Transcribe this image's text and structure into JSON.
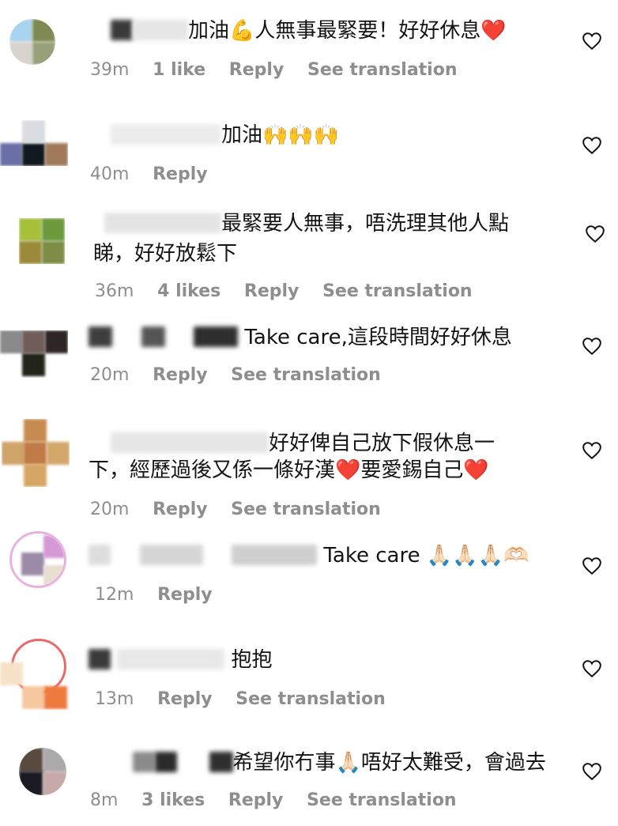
{
  "comments": [
    {
      "text": "加油💪人無事最緊要！好好休息❤️",
      "time": "39m",
      "likes": "1 like",
      "reply": "Reply",
      "translate": "See translation"
    },
    {
      "text": "加油🙌🙌🙌",
      "time": "40m",
      "likes": "",
      "reply": "Reply",
      "translate": ""
    },
    {
      "text_line1": "最緊要人無事，唔洗理其他人點",
      "text_line2": "睇，好好放鬆下",
      "time": "36m",
      "likes": "4 likes",
      "reply": "Reply",
      "translate": "See translation"
    },
    {
      "text": "Take care,這段時間好好休息",
      "time": "20m",
      "likes": "",
      "reply": "Reply",
      "translate": "See translation"
    },
    {
      "text_line1": "好好俾自己放下假休息一",
      "text_line2": "下，經歷過後又係一條好漢❤️要愛錫自己❤️",
      "time": "20m",
      "likes": "",
      "reply": "Reply",
      "translate": "See translation"
    },
    {
      "text": "Take care 🙏🏻🙏🏻🙏🏻🫶🏻",
      "time": "12m",
      "likes": "",
      "reply": "Reply",
      "translate": ""
    },
    {
      "text": "抱抱",
      "time": "13m",
      "likes": "",
      "reply": "Reply",
      "translate": "See translation"
    },
    {
      "text": "希望你冇事🙏🏻唔好太難受，會過去",
      "time": "8m",
      "likes": "3 likes",
      "reply": "Reply",
      "translate": "See translation"
    }
  ],
  "icons": {
    "like": "heart-outline-icon"
  },
  "colors": {
    "meta": "#8e8e8e",
    "text": "#141414"
  }
}
